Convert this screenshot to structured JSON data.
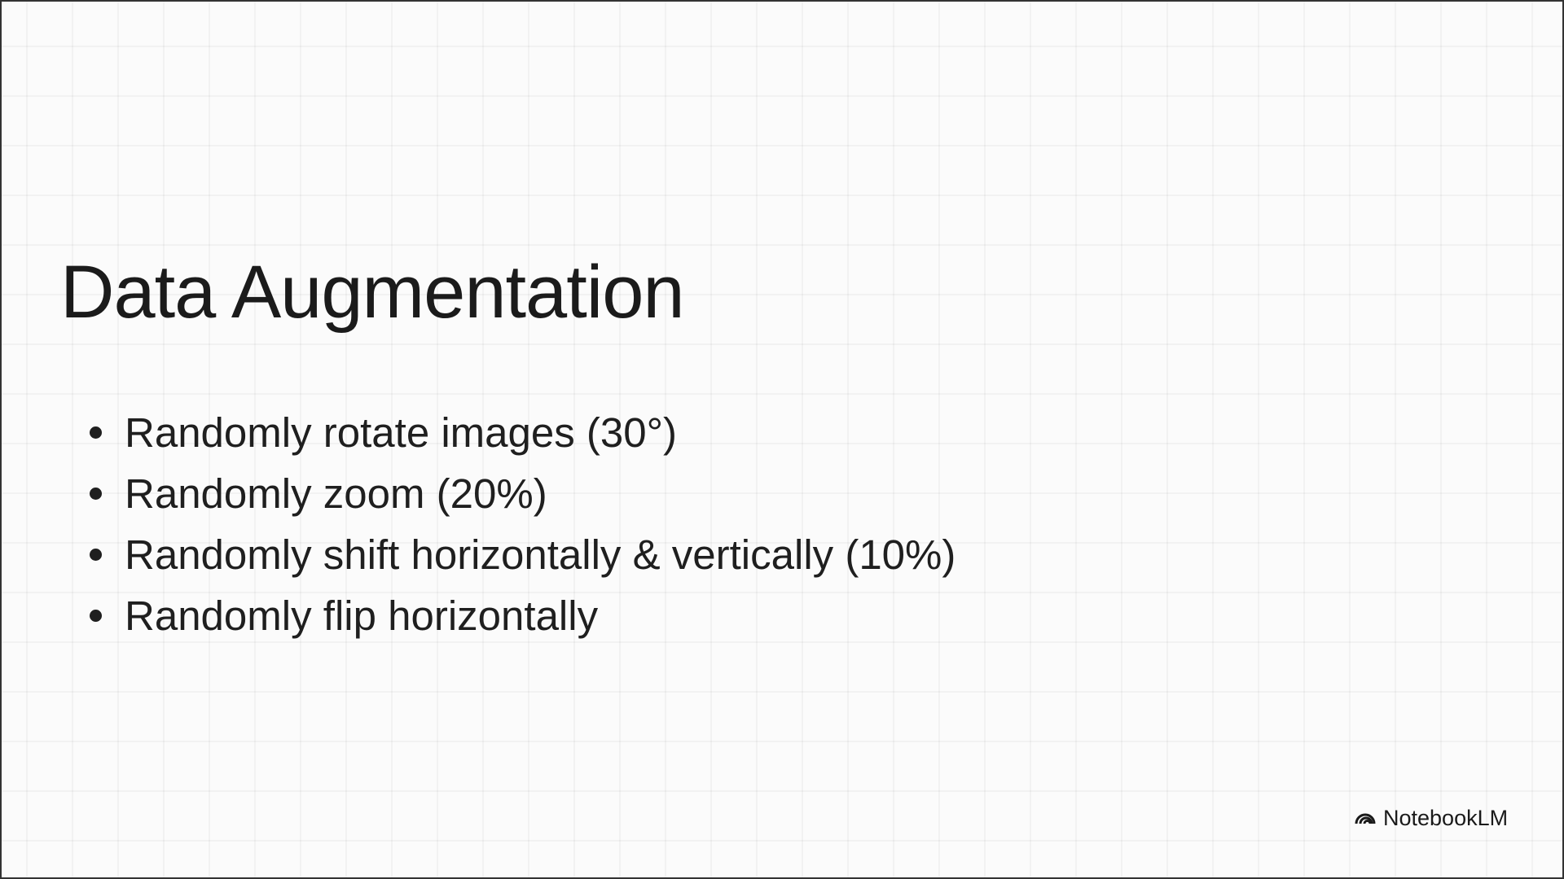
{
  "slide": {
    "title": "Data Augmentation",
    "bullets": [
      "Randomly rotate images (30°)",
      "Randomly zoom (20%)",
      "Randomly shift horizontally & vertically (10%)",
      "Randomly flip horizontally"
    ]
  },
  "branding": {
    "logo_icon": "notebooklm-arcs-icon",
    "logo_text": "NotebookLM"
  }
}
